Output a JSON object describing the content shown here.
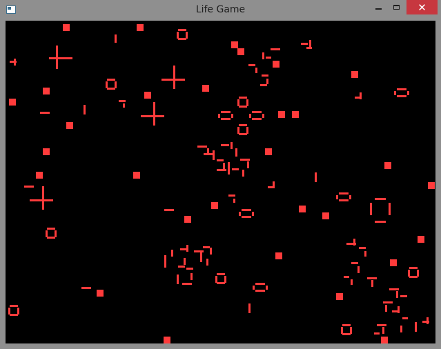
{
  "window": {
    "title": "Life Game",
    "close_glyph": "✕",
    "icons": {
      "app": "app-icon",
      "minimize": "minimize-icon",
      "maximize": "maximize-icon",
      "close": "close-icon"
    }
  },
  "board": {
    "background": "#000000",
    "cell_color": "#ff3b3b"
  }
}
